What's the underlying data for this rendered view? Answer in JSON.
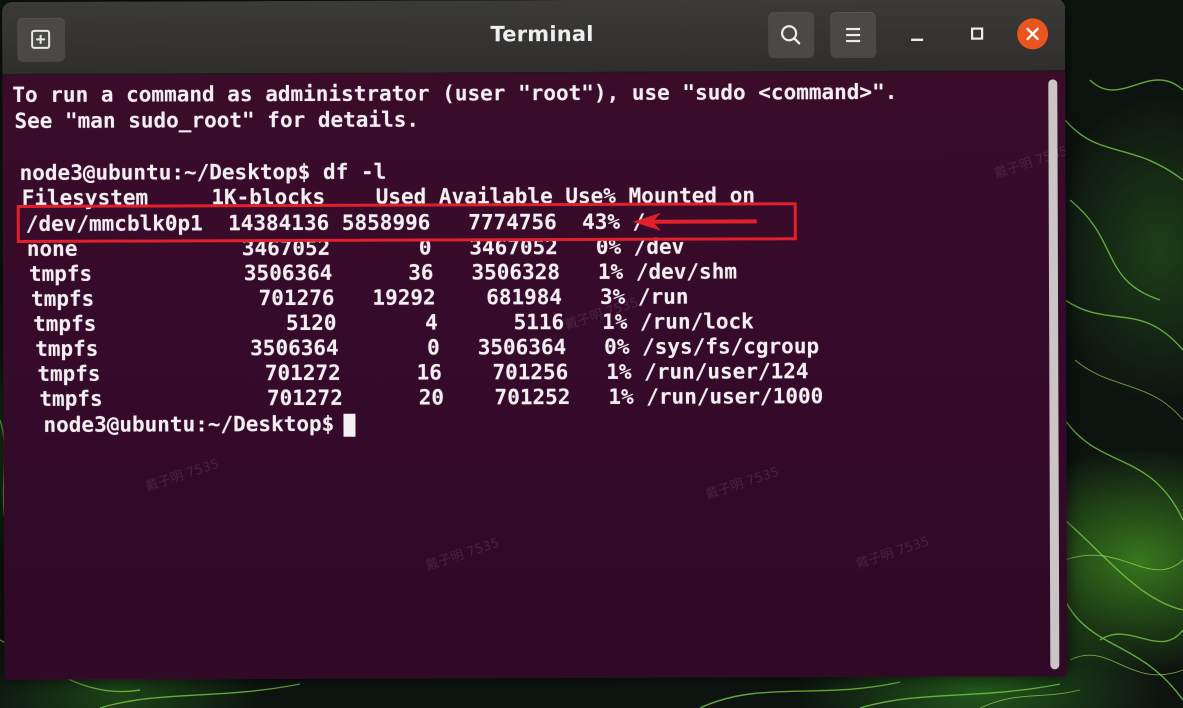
{
  "window": {
    "title": "Terminal"
  },
  "terminal": {
    "intro": [
      "To run a command as administrator (user \"root\"), use \"sudo <command>\".",
      "See \"man sudo_root\" for details."
    ],
    "command_prompt": "node3@ubuntu:~/Desktop$ df -l",
    "table_header": "Filesystem     1K-blocks    Used Available Use% Mounted on",
    "rows": [
      "/dev/mmcblk0p1  14384136 5858996   7774756  43% /",
      "none             3467052       0   3467052   0% /dev",
      "tmpfs            3506364      36   3506328   1% /dev/shm",
      "tmpfs             701276   19292    681984   3% /run",
      "tmpfs               5120       4      5116   1% /run/lock",
      "tmpfs            3506364       0   3506364   0% /sys/fs/cgroup",
      "tmpfs             701272      16    701256   1% /run/user/124",
      "tmpfs             701272      20    701252   1% /run/user/1000"
    ],
    "final_prompt": "node3@ubuntu:~/Desktop$ "
  },
  "annotation": {
    "highlight_color": "#e2202a",
    "highlighted_row_index": 0
  },
  "watermark": {
    "text": "戴子明 7535"
  },
  "colors": {
    "terminal_bg": "#3a0c2a",
    "text": "#f3eef1",
    "titlebar": "#353432",
    "close_button": "#e9541f"
  }
}
